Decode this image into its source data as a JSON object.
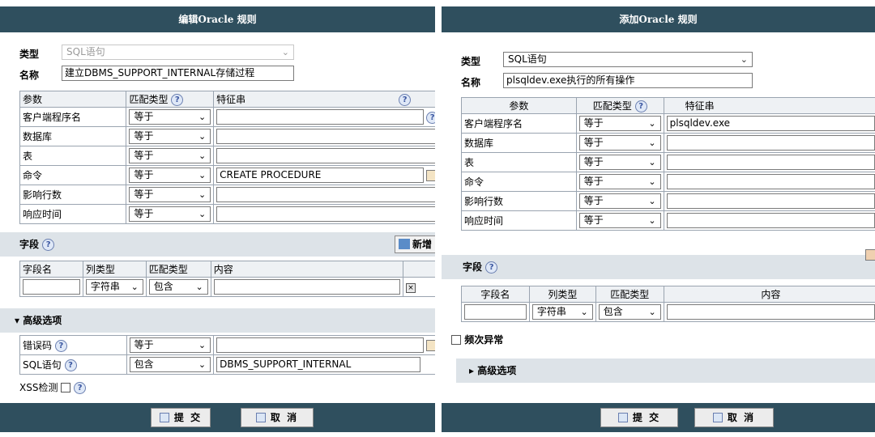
{
  "left": {
    "title": "编辑Oracle 规则",
    "type_label": "类型",
    "type_value": "SQL语句",
    "name_label": "名称",
    "name_value": "建立DBMS_SUPPORT_INTERNAL存储过程",
    "params_table": {
      "headers": [
        "参数",
        "匹配类型",
        "特征串"
      ],
      "rows": [
        {
          "param": "客户端程序名",
          "match": "等于",
          "feature": ""
        },
        {
          "param": "数据库",
          "match": "等于",
          "feature": ""
        },
        {
          "param": "表",
          "match": "等于",
          "feature": ""
        },
        {
          "param": "命令",
          "match": "等于",
          "feature": "CREATE PROCEDURE"
        },
        {
          "param": "影响行数",
          "match": "等于",
          "feature": ""
        },
        {
          "param": "响应时间",
          "match": "等于",
          "feature": ""
        }
      ]
    },
    "fields_section": {
      "label": "字段",
      "new_label": "新增"
    },
    "fields_table": {
      "headers": [
        "字段名",
        "列类型",
        "匹配类型",
        "内容"
      ],
      "row": {
        "name": "",
        "col_type": "字符串",
        "match": "包含",
        "content": ""
      }
    },
    "advanced_label": "高级选项",
    "advanced_rows": [
      {
        "label": "错误码",
        "match": "等于",
        "value": ""
      },
      {
        "label": "SQL语句",
        "match": "包含",
        "value": "DBMS_SUPPORT_INTERNAL"
      }
    ],
    "xss_label": "XSS检测",
    "submit_label": "提 交",
    "cancel_label": "取 消"
  },
  "right": {
    "title": "添加Oracle 规则",
    "type_label": "类型",
    "type_value": "SQL语句",
    "name_label": "名称",
    "name_value": "plsqldev.exe执行的所有操作",
    "params_table": {
      "headers": [
        "参数",
        "匹配类型",
        "特征串"
      ],
      "rows": [
        {
          "param": "客户端程序名",
          "match": "等于",
          "feature": "plsqldev.exe"
        },
        {
          "param": "数据库",
          "match": "等于",
          "feature": ""
        },
        {
          "param": "表",
          "match": "等于",
          "feature": ""
        },
        {
          "param": "命令",
          "match": "等于",
          "feature": ""
        },
        {
          "param": "影响行数",
          "match": "等于",
          "feature": ""
        },
        {
          "param": "响应时间",
          "match": "等于",
          "feature": ""
        }
      ]
    },
    "fields_section": {
      "label": "字段"
    },
    "fields_table": {
      "headers": [
        "字段名",
        "列类型",
        "匹配类型",
        "内容"
      ],
      "row": {
        "name": "",
        "col_type": "字符串",
        "match": "包含",
        "content": ""
      }
    },
    "frequency_label": "频次异常",
    "advanced_label": "高级选项",
    "submit_label": "提 交",
    "cancel_label": "取 消"
  },
  "colors": {
    "titlebar": "#2f4f5e",
    "section": "#dde3e8",
    "header_row": "#eef1f4"
  },
  "icons": [
    "help-icon",
    "chevron-down-icon",
    "add-icon",
    "delete-icon",
    "submit-icon",
    "cancel-icon",
    "collapse-icon",
    "expand-icon",
    "edit-icon"
  ]
}
